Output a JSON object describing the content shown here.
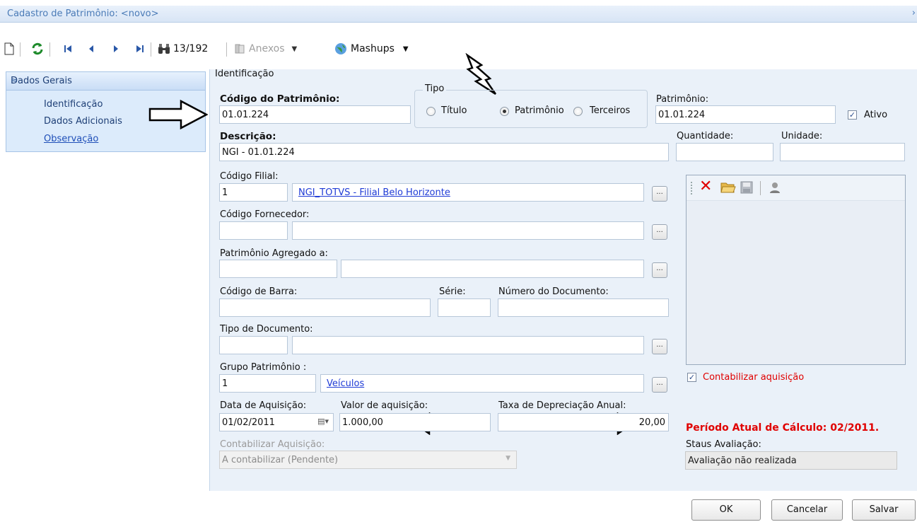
{
  "window": {
    "title": "Cadastro de Patrimônio: <novo>",
    "close_glyph": "›"
  },
  "toolbar": {
    "record_counter": "13/192",
    "anexos_label": "Anexos",
    "mashups_label": "Mashups",
    "icons": [
      "new-document-icon",
      "refresh-icon",
      "first-record-icon",
      "previous-record-icon",
      "next-record-icon",
      "last-record-icon",
      "binoculars-search-icon",
      "attachment-icon",
      "globe-mashups-icon"
    ]
  },
  "sidebar": {
    "header": "Dados Gerais",
    "items": [
      {
        "label": "Identificação"
      },
      {
        "label": "Dados Adicionais"
      },
      {
        "label": "Observação"
      }
    ]
  },
  "form": {
    "section_label": "Identificação",
    "codigo_patrimonio": {
      "label": "Código do Patrimônio:",
      "value": "01.01.224"
    },
    "tipo": {
      "label": "Tipo",
      "options": [
        "Título",
        "Patrimônio",
        "Terceiros"
      ],
      "selected": "Patrimônio"
    },
    "patrimonio": {
      "label": "Patrimônio:",
      "value": "01.01.224"
    },
    "ativo": {
      "label": "Ativo",
      "checked": true
    },
    "descricao": {
      "label": "Descrição:",
      "value": "NGI - 01.01.224"
    },
    "quantidade": {
      "label": "Quantidade:",
      "value": ""
    },
    "unidade": {
      "label": "Unidade:",
      "value": ""
    },
    "codigo_filial": {
      "label": "Código Filial:",
      "code": "1",
      "name": "NGI_TOTVS - Filial Belo Horizonte"
    },
    "codigo_fornecedor": {
      "label": "Código Fornecedor:",
      "code": "",
      "name": ""
    },
    "patrimonio_agregado": {
      "label": "Patrimônio Agregado a:",
      "code": "",
      "name": ""
    },
    "codigo_barra": {
      "label": "Código de Barra:",
      "value": ""
    },
    "serie": {
      "label": "Série:",
      "value": ""
    },
    "numero_documento": {
      "label": "Número do Documento:",
      "value": ""
    },
    "tipo_documento": {
      "label": "Tipo de Documento:",
      "code": "",
      "name": ""
    },
    "grupo_patrimonio": {
      "label": "Grupo Patrimônio :",
      "code": "1",
      "name": "Veículos"
    },
    "data_aquisicao": {
      "label": "Data de Aquisição:",
      "value": "01/02/2011"
    },
    "valor_aquisicao": {
      "label": "Valor de aquisição:",
      "value": "1.000,00"
    },
    "taxa_depreciacao": {
      "label": "Taxa de Depreciação Anual:",
      "value": "20,00"
    },
    "contabilizar_aquisicao_select": {
      "label": "Contabilizar Aquisição:",
      "value": "A contabilizar (Pendente)"
    },
    "contabilizar_aquisicao_check": {
      "label": "Contabilizar aquisição",
      "checked": true
    },
    "periodo_atual": "Período Atual de Cálculo: 02/2011.",
    "status_avaliacao": {
      "label": "Staus Avaliação:",
      "value": "Avaliação não realizada"
    },
    "ellipsis_glyph": "...",
    "image_toolbar_icons": [
      "delete-x-icon",
      "open-folder-icon",
      "save-disk-icon",
      "user-photo-icon"
    ]
  },
  "buttons": {
    "ok": "OK",
    "cancel": "Cancelar",
    "save": "Salvar"
  },
  "colors": {
    "accent": "#4a7bb7",
    "panel": "#eaf1f9",
    "alert": "#e00000",
    "link": "#1f3bd6"
  }
}
